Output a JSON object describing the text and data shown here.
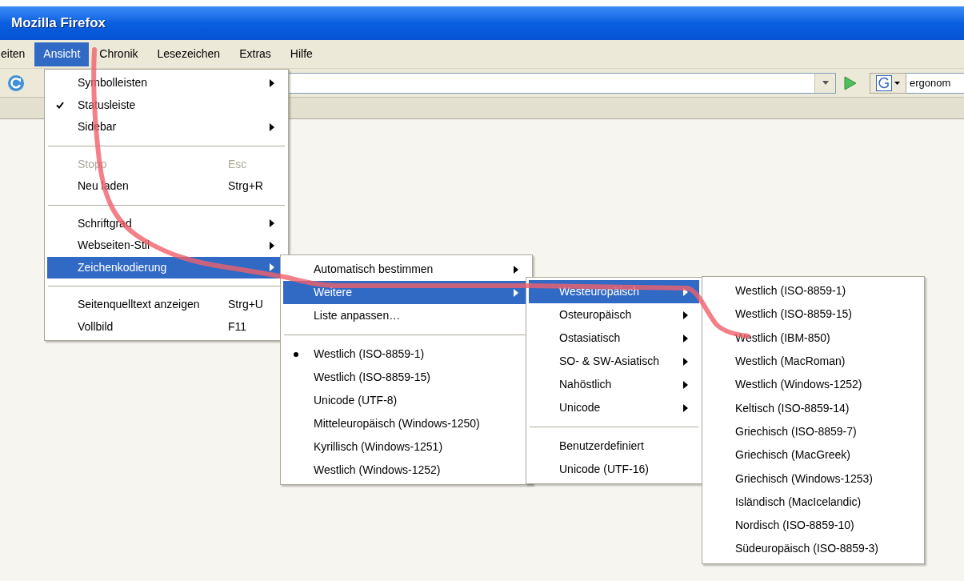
{
  "window": {
    "title": "Mozilla Firefox"
  },
  "menubar": [
    {
      "label": "eiten",
      "selected": false
    },
    {
      "label": "Ansicht",
      "selected": true
    },
    {
      "label": "Chronik",
      "selected": false
    },
    {
      "label": "Lesezeichen",
      "selected": false
    },
    {
      "label": "Extras",
      "selected": false
    },
    {
      "label": "Hilfe",
      "selected": false
    }
  ],
  "toolbar": {
    "search": {
      "value": "ergonom"
    }
  },
  "menus": [
    {
      "items": [
        {
          "kind": "submenu",
          "label": "Symbolleisten",
          "selected": false,
          "disabled": false
        },
        {
          "kind": "check",
          "label": "Statusleiste",
          "checked": true,
          "selected": false,
          "disabled": false
        },
        {
          "kind": "submenu",
          "label": "Sidebar",
          "selected": false,
          "disabled": false
        },
        {
          "kind": "separator"
        },
        {
          "kind": "command",
          "label": "Stopp",
          "shortcut": "Esc",
          "selected": false,
          "disabled": true
        },
        {
          "kind": "command",
          "label": "Neu laden",
          "shortcut": "Strg+R",
          "selected": false,
          "disabled": false
        },
        {
          "kind": "separator"
        },
        {
          "kind": "submenu",
          "label": "Schriftgrad",
          "selected": false,
          "disabled": false
        },
        {
          "kind": "submenu",
          "label": "Webseiten-Stil",
          "selected": false,
          "disabled": false
        },
        {
          "kind": "submenu",
          "label": "Zeichenkodierung",
          "selected": true,
          "disabled": false
        },
        {
          "kind": "separator"
        },
        {
          "kind": "command",
          "label": "Seitenquelltext anzeigen",
          "shortcut": "Strg+U",
          "selected": false,
          "disabled": false
        },
        {
          "kind": "command",
          "label": "Vollbild",
          "shortcut": "F11",
          "selected": false,
          "disabled": false
        }
      ]
    },
    {
      "items": [
        {
          "kind": "submenu",
          "label": "Automatisch bestimmen",
          "selected": false,
          "disabled": false
        },
        {
          "kind": "submenu",
          "label": "Weitere",
          "selected": true,
          "disabled": false
        },
        {
          "kind": "command",
          "label": "Liste anpassen…",
          "selected": false,
          "disabled": false
        },
        {
          "kind": "separator"
        },
        {
          "kind": "radio",
          "label": "Westlich (ISO-8859-1)",
          "checked": true,
          "selected": false,
          "disabled": false
        },
        {
          "kind": "radio",
          "label": "Westlich (ISO-8859-15)",
          "checked": false,
          "selected": false,
          "disabled": false
        },
        {
          "kind": "radio",
          "label": "Unicode (UTF-8)",
          "checked": false,
          "selected": false,
          "disabled": false
        },
        {
          "kind": "radio",
          "label": "Mitteleuropäisch (Windows-1250)",
          "checked": false,
          "selected": false,
          "disabled": false
        },
        {
          "kind": "radio",
          "label": "Kyrillisch (Windows-1251)",
          "checked": false,
          "selected": false,
          "disabled": false
        },
        {
          "kind": "radio",
          "label": "Westlich (Windows-1252)",
          "checked": false,
          "selected": false,
          "disabled": false
        }
      ]
    },
    {
      "items": [
        {
          "kind": "submenu",
          "label": "Westeuropäisch",
          "selected": true,
          "disabled": false
        },
        {
          "kind": "submenu",
          "label": "Osteuropäisch",
          "selected": false,
          "disabled": false
        },
        {
          "kind": "submenu",
          "label": "Ostasiatisch",
          "selected": false,
          "disabled": false
        },
        {
          "kind": "submenu",
          "label": "SO- & SW-Asiatisch",
          "selected": false,
          "disabled": false
        },
        {
          "kind": "submenu",
          "label": "Nahöstlich",
          "selected": false,
          "disabled": false
        },
        {
          "kind": "submenu",
          "label": "Unicode",
          "selected": false,
          "disabled": false
        },
        {
          "kind": "separator"
        },
        {
          "kind": "command",
          "label": "Benutzerdefiniert",
          "selected": false,
          "disabled": false
        },
        {
          "kind": "command",
          "label": "Unicode (UTF-16)",
          "selected": false,
          "disabled": false
        }
      ]
    },
    {
      "items": [
        {
          "kind": "command",
          "label": "Westlich (ISO-8859-1)",
          "selected": false,
          "disabled": false
        },
        {
          "kind": "command",
          "label": "Westlich (ISO-8859-15)",
          "selected": false,
          "disabled": false
        },
        {
          "kind": "command",
          "label": "Westlich (IBM-850)",
          "selected": false,
          "disabled": false
        },
        {
          "kind": "command",
          "label": "Westlich (MacRoman)",
          "selected": false,
          "disabled": false
        },
        {
          "kind": "command",
          "label": "Westlich (Windows-1252)",
          "selected": false,
          "disabled": false
        },
        {
          "kind": "command",
          "label": "Keltisch (ISO-8859-14)",
          "selected": false,
          "disabled": false
        },
        {
          "kind": "command",
          "label": "Griechisch (ISO-8859-7)",
          "selected": false,
          "disabled": false
        },
        {
          "kind": "command",
          "label": "Griechisch (MacGreek)",
          "selected": false,
          "disabled": false
        },
        {
          "kind": "command",
          "label": "Griechisch (Windows-1253)",
          "selected": false,
          "disabled": false
        },
        {
          "kind": "command",
          "label": "Isländisch (MacIcelandic)",
          "selected": false,
          "disabled": false
        },
        {
          "kind": "command",
          "label": "Nordisch (ISO-8859-10)",
          "selected": false,
          "disabled": false
        },
        {
          "kind": "command",
          "label": "Südeuropäisch (ISO-8859-3)",
          "selected": false,
          "disabled": false
        }
      ]
    }
  ]
}
